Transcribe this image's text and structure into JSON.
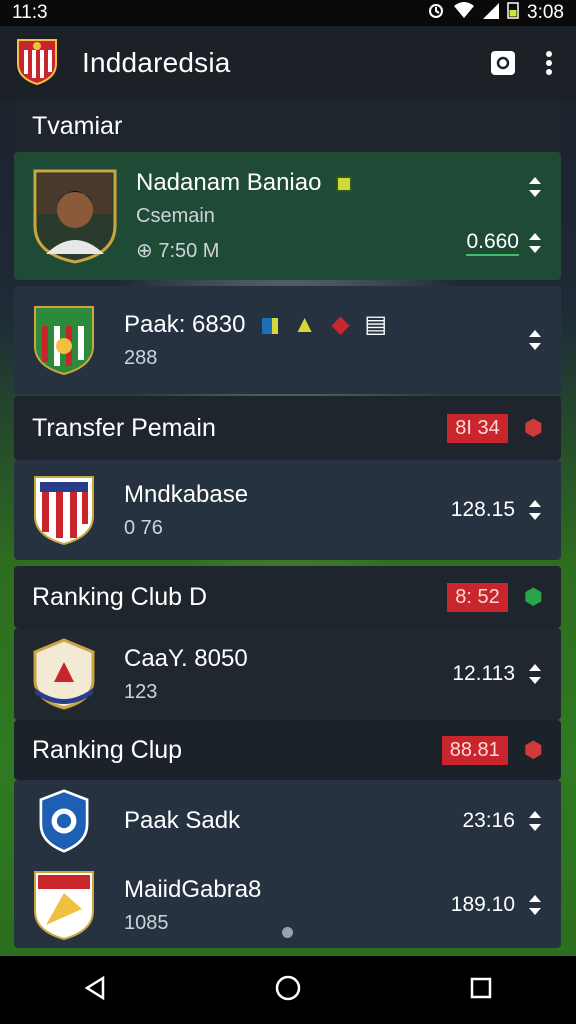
{
  "status_bar": {
    "time_left": "11:3",
    "time_right": "3:08"
  },
  "app_bar": {
    "title": "Inddaredsia"
  },
  "top_section": {
    "title": "Tvamiar"
  },
  "player": {
    "name": "Nadanam Baniao",
    "position": "Csemain",
    "value": "7:50 M",
    "rating": "0.660"
  },
  "club_card": {
    "name": "Paak: 6830",
    "points": "288"
  },
  "transfer": {
    "title": "Transfer Pemain",
    "badge": "8I 34",
    "club": {
      "name": "Mndkabase",
      "points": "0 76",
      "value": "128.15"
    }
  },
  "ranking_d": {
    "title": "Ranking Club D",
    "badge": "8: 52",
    "club": {
      "name": "CaaY. 8050",
      "sub": "123",
      "value": "12.113"
    }
  },
  "ranking": {
    "title": "Ranking Clup",
    "badge": "88.81",
    "clubs": [
      {
        "name": "Paak Sadk",
        "value": "23:16"
      },
      {
        "name": "MaiidGabra8",
        "sub": "1085",
        "value": "189.10"
      }
    ]
  },
  "colors": {
    "accent_green": "#2f8a3a",
    "badge_red": "#c8252d",
    "dark_card": "#263240"
  }
}
